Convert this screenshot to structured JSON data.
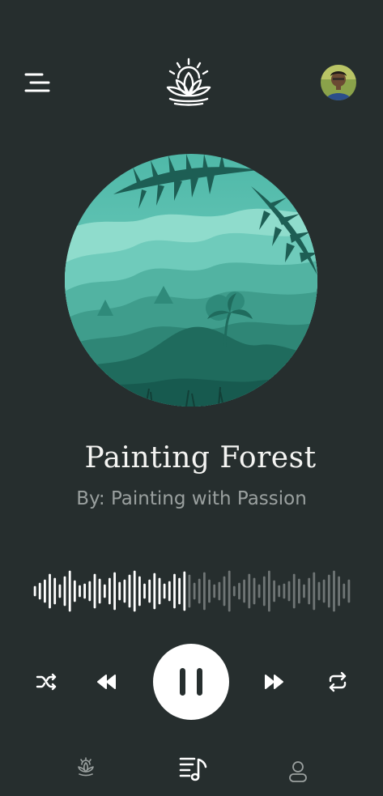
{
  "track": {
    "title": "Painting Forest",
    "artist": "By: Painting with Passion",
    "progress_fraction": 0.48
  },
  "header": {
    "menu_icon": "hamburger-menu-icon",
    "logo_icon": "lotus-sun-logo",
    "avatar_icon": "user-avatar"
  },
  "controls": {
    "shuffle_icon": "shuffle-icon",
    "previous_icon": "rewind-icon",
    "pause_icon": "pause-icon",
    "next_icon": "fast-forward-icon",
    "repeat_icon": "repeat-icon"
  },
  "bottom_nav": {
    "items": [
      {
        "icon": "lotus-icon",
        "active": false
      },
      {
        "icon": "playlist-music-icon",
        "active": true
      },
      {
        "icon": "profile-icon",
        "active": false
      }
    ]
  },
  "colors": {
    "background": "#262e2e",
    "text_primary": "#f4f4f2",
    "text_secondary": "#9aa09f",
    "wave_played": "#ffffff",
    "wave_unplayed": "#6f7575",
    "art_teal": "#5fc9b9"
  }
}
